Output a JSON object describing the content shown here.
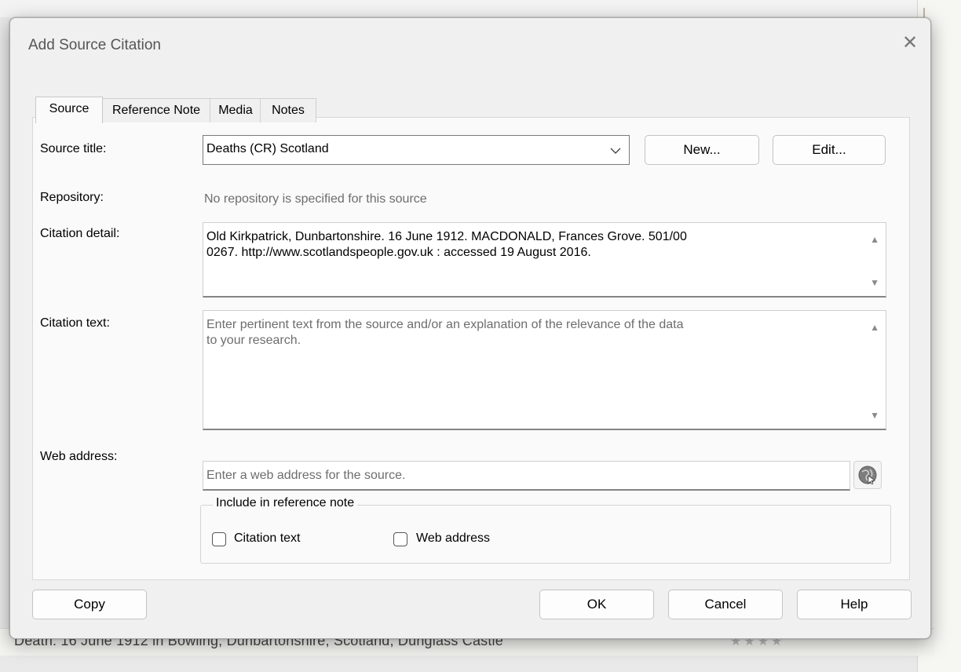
{
  "background": {
    "row_text": "Death: 16 June 1912 in Bowling, Dunbartonshire, Scotland, Dunglass Castle"
  },
  "dialog": {
    "title": "Add Source Citation",
    "close_glyph": "✕"
  },
  "tabs": [
    {
      "label": "Source",
      "active": true
    },
    {
      "label": "Reference Note",
      "active": false
    },
    {
      "label": "Media",
      "active": false
    },
    {
      "label": "Notes",
      "active": false
    }
  ],
  "source": {
    "source_title_label": "Source title:",
    "source_title_value": "Deaths (CR) Scotland",
    "new_button": "New...",
    "edit_button": "Edit...",
    "repository_label": "Repository:",
    "repository_value": "No repository is specified for this source",
    "citation_detail_label": "Citation detail:",
    "citation_detail_value": "Old Kirkpatrick, Dunbartonshire. 16 June 1912. MACDONALD, Frances Grove. 501/00\n0267. http://www.scotlandspeople.gov.uk : accessed 19 August 2016.",
    "citation_text_label": "Citation text:",
    "citation_text_placeholder": "Enter pertinent text from the source and/or an explanation of the relevance of the data\nto your research.",
    "web_address_label": "Web address:",
    "web_address_placeholder": "Enter a web address for the source.",
    "include_group_label": "Include in reference note",
    "include_citation_text_label": "Citation text",
    "include_citation_text_checked": false,
    "include_web_address_label": "Web address",
    "include_web_address_checked": false
  },
  "footer": {
    "copy_button": "Copy",
    "ok_button": "OK",
    "cancel_button": "Cancel",
    "help_button": "Help"
  },
  "icons": {
    "dropdown": "chevron-down-icon",
    "scroll_up": "scroll-up-icon",
    "scroll_down": "scroll-down-icon",
    "web": "globe-icon"
  }
}
